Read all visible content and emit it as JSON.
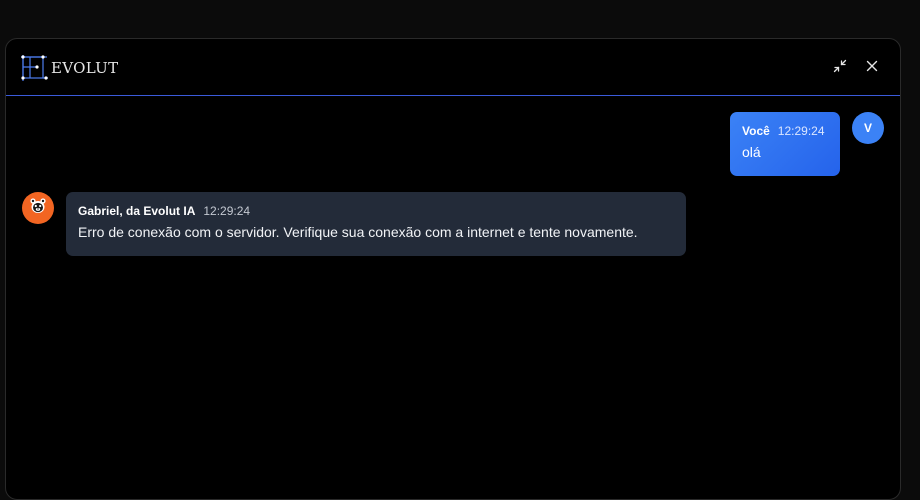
{
  "header": {
    "brand": "EVOLUT",
    "logo_icon": "evolut-logo-icon",
    "minimize_icon": "minimize-arrows-icon",
    "close_icon": "close-icon",
    "divider_color": "#3b5bdb"
  },
  "messages": [
    {
      "author": "Você",
      "time": "12:29:24",
      "text": "olá",
      "avatar_initial": "V",
      "bubble_color": "#3b82f6"
    },
    {
      "author": "Gabriel, da Evolut IA",
      "time": "12:29:24",
      "text": "Erro de conexão com o servidor. Verifique sua conexão com a internet e tente novamente.",
      "avatar_icon": "bear-mascot-icon",
      "avatar_color": "#f26522",
      "bubble_color": "#232b39"
    }
  ]
}
